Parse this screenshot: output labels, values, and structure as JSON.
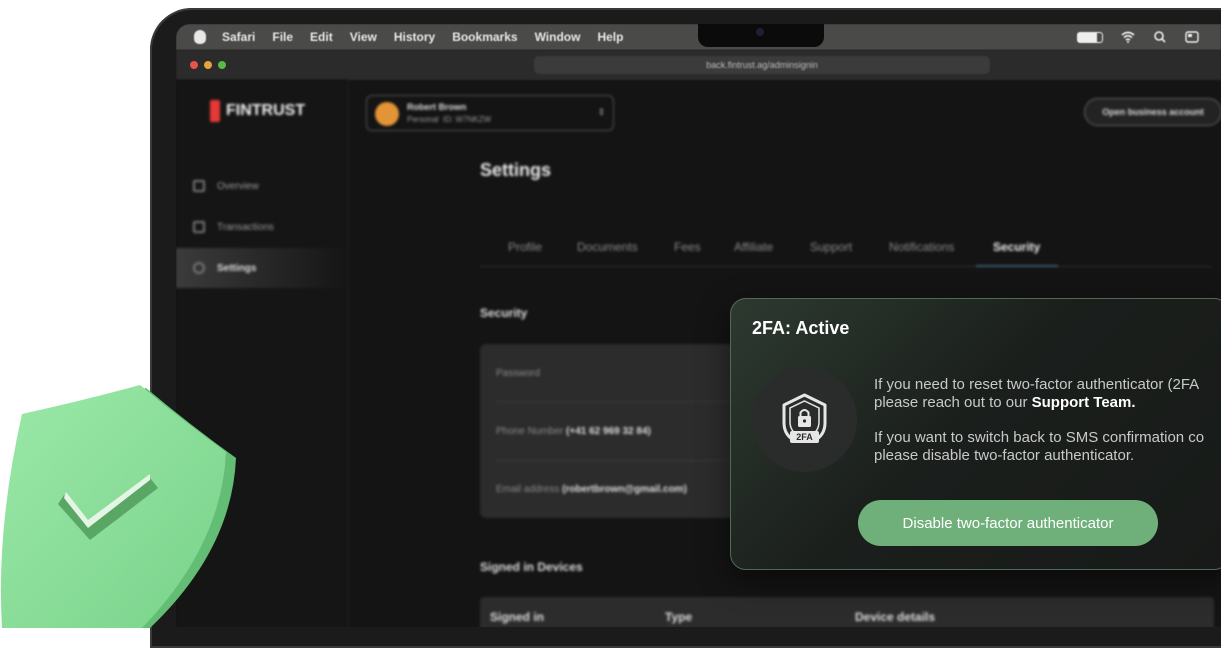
{
  "menubar": {
    "app": "Safari",
    "items": [
      "File",
      "Edit",
      "View",
      "History",
      "Bookmarks",
      "Window",
      "Help"
    ],
    "icons": [
      "apple-icon",
      "battery-icon",
      "wifi-icon",
      "search-icon",
      "control-center-icon"
    ]
  },
  "browser": {
    "url": "back.fintrust.ag/adminsignin"
  },
  "brand": {
    "name": "FINTRUST",
    "accent": "#e53935"
  },
  "account": {
    "name": "Robert Brown",
    "type": "Personal",
    "id": "ID: W7NKZW"
  },
  "header": {
    "open_business": "Open business account"
  },
  "sidebar": {
    "items": [
      {
        "label": "Overview",
        "icon": "grid-icon"
      },
      {
        "label": "Transactions",
        "icon": "document-icon"
      },
      {
        "label": "Settings",
        "icon": "gear-icon"
      }
    ],
    "active": "Settings"
  },
  "page": {
    "title": "Settings",
    "tabs": [
      "Profile",
      "Documents",
      "Fees",
      "Affiliate",
      "Support",
      "Notifications",
      "Security"
    ],
    "active_tab": "Security"
  },
  "security": {
    "heading": "Security",
    "password_label": "Password",
    "phone_label": "Phone Number",
    "phone_value": "(+41 62 969 32 84)",
    "email_label": "Email address",
    "email_value": "(robertbrown@gmail.com)"
  },
  "devices": {
    "heading": "Signed in Devices",
    "columns": [
      "Signed in",
      "Type",
      "Device details"
    ]
  },
  "twofa": {
    "title": "2FA: Active",
    "badge": "2FA",
    "para1_line1": "If you need to reset two-factor authenticator (2FA",
    "para1_line2_pre": "please reach out to our ",
    "para1_link": "Support Team.",
    "para2_line1": "If you want to switch back to SMS confirmation co",
    "para2_line2": "please disable two-factor authenticator.",
    "button": "Disable two-factor authenticator",
    "accent": "#6fb07a"
  }
}
